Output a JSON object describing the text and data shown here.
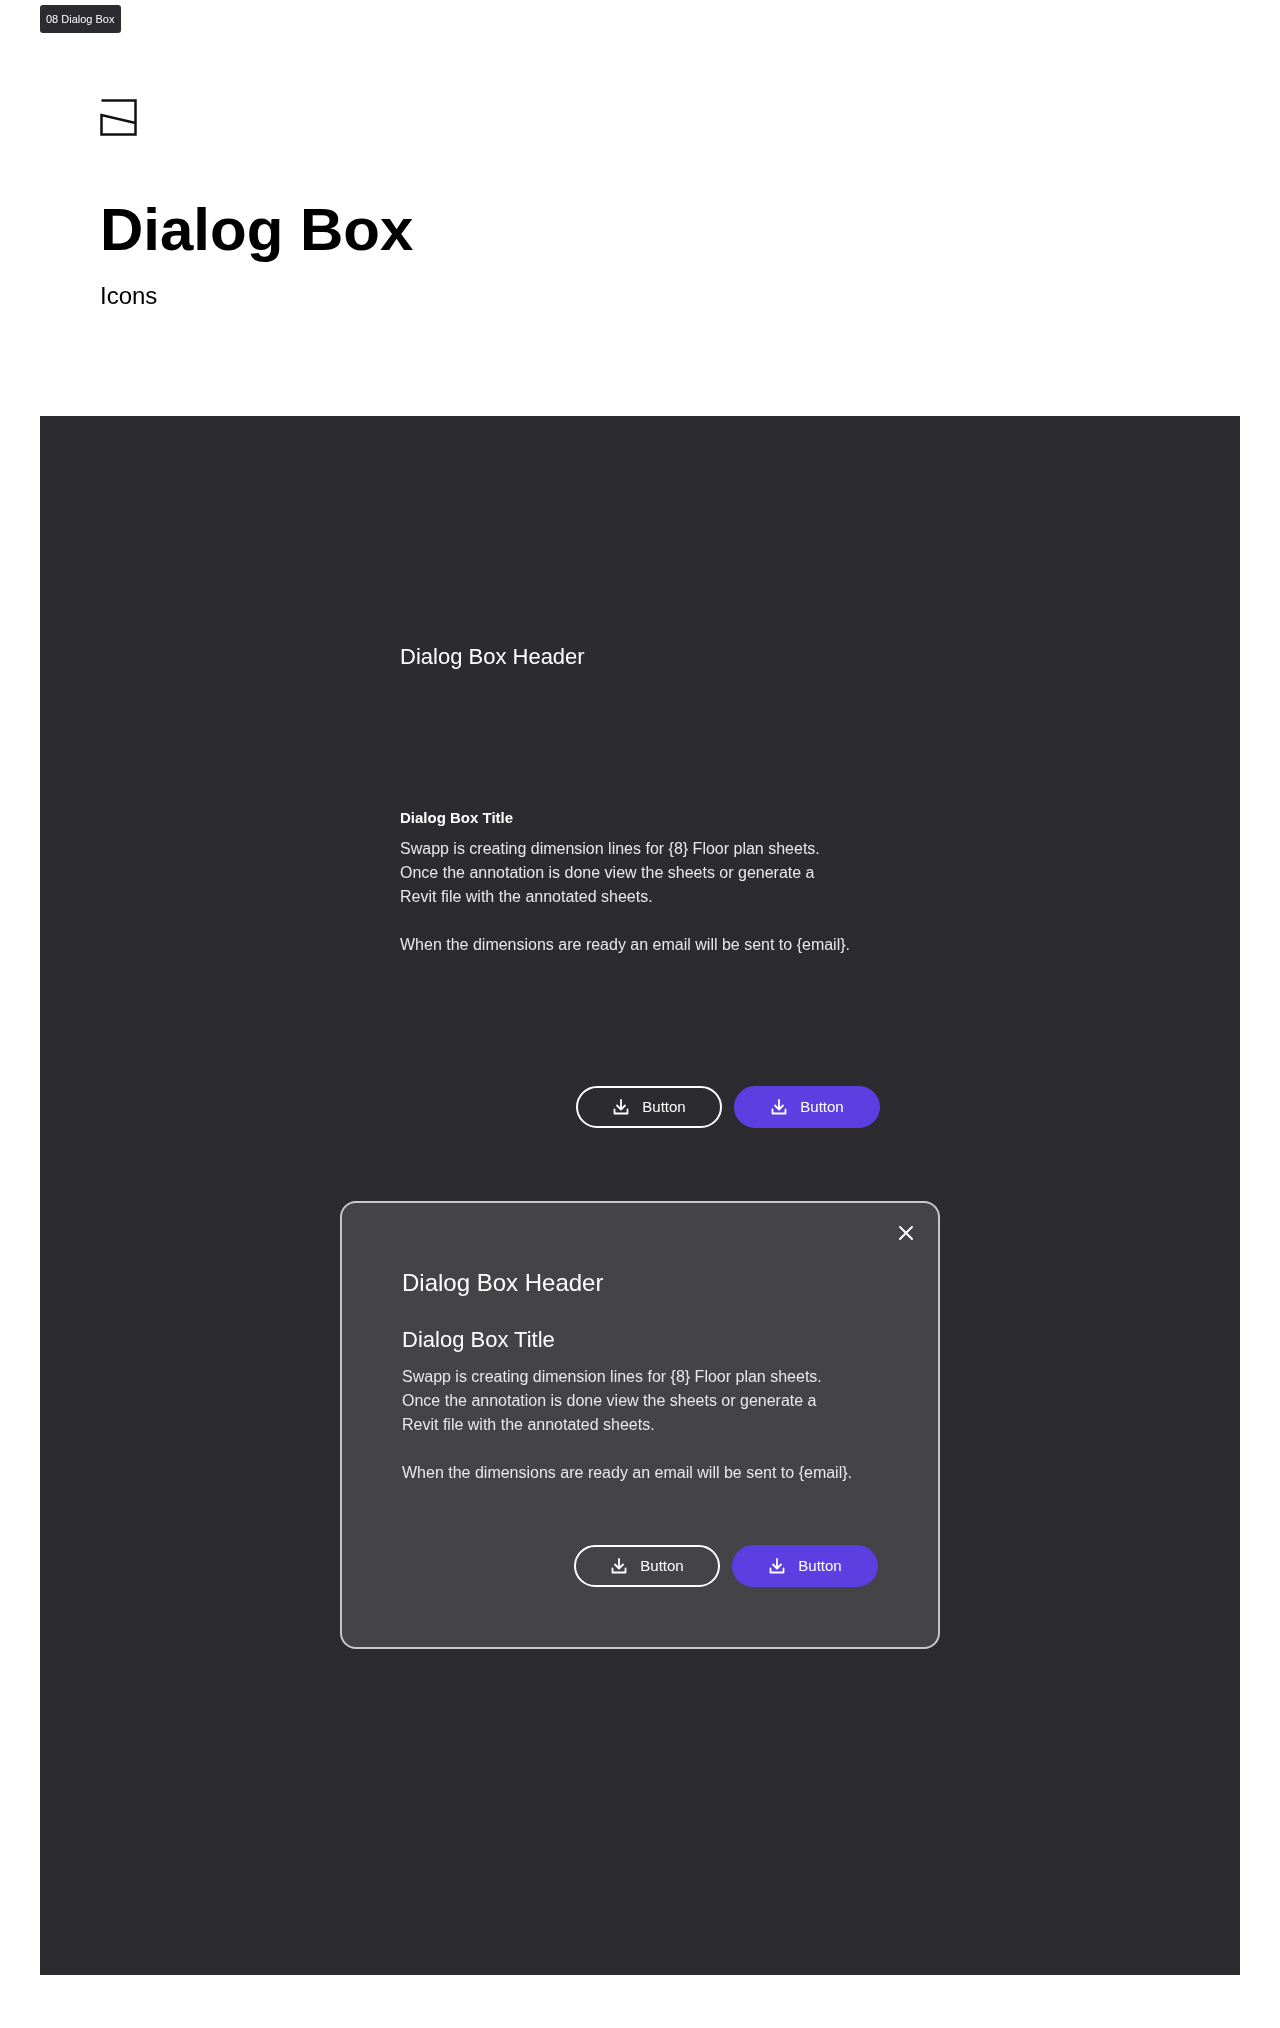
{
  "tag": "08 Dialog Box",
  "page": {
    "title": "Dialog Box",
    "subtitle": "Icons"
  },
  "dialogs": [
    {
      "kind": "plain",
      "header": "Dialog Box Header",
      "title": "Dialog Box Title",
      "paragraphs": [
        "Swapp is creating dimension lines for {8} Floor plan sheets. Once the annotation is done view the sheets or generate a Revit file with the annotated sheets.",
        "When the dimensions are ready an email will be sent to {email}."
      ],
      "buttons": [
        {
          "label": "Button",
          "kind": "outline"
        },
        {
          "label": "Button",
          "kind": "primary"
        }
      ]
    },
    {
      "kind": "modal",
      "header": "Dialog Box Header",
      "title": "Dialog Box Title",
      "paragraphs": [
        "Swapp is creating dimension lines for {8} Floor plan sheets. Once the annotation is done view the sheets or generate a Revit file with the annotated sheets.",
        "When the dimensions are ready an email will be sent to {email}."
      ],
      "buttons": [
        {
          "label": "Button",
          "kind": "outline"
        },
        {
          "label": "Button",
          "kind": "primary"
        }
      ]
    }
  ]
}
